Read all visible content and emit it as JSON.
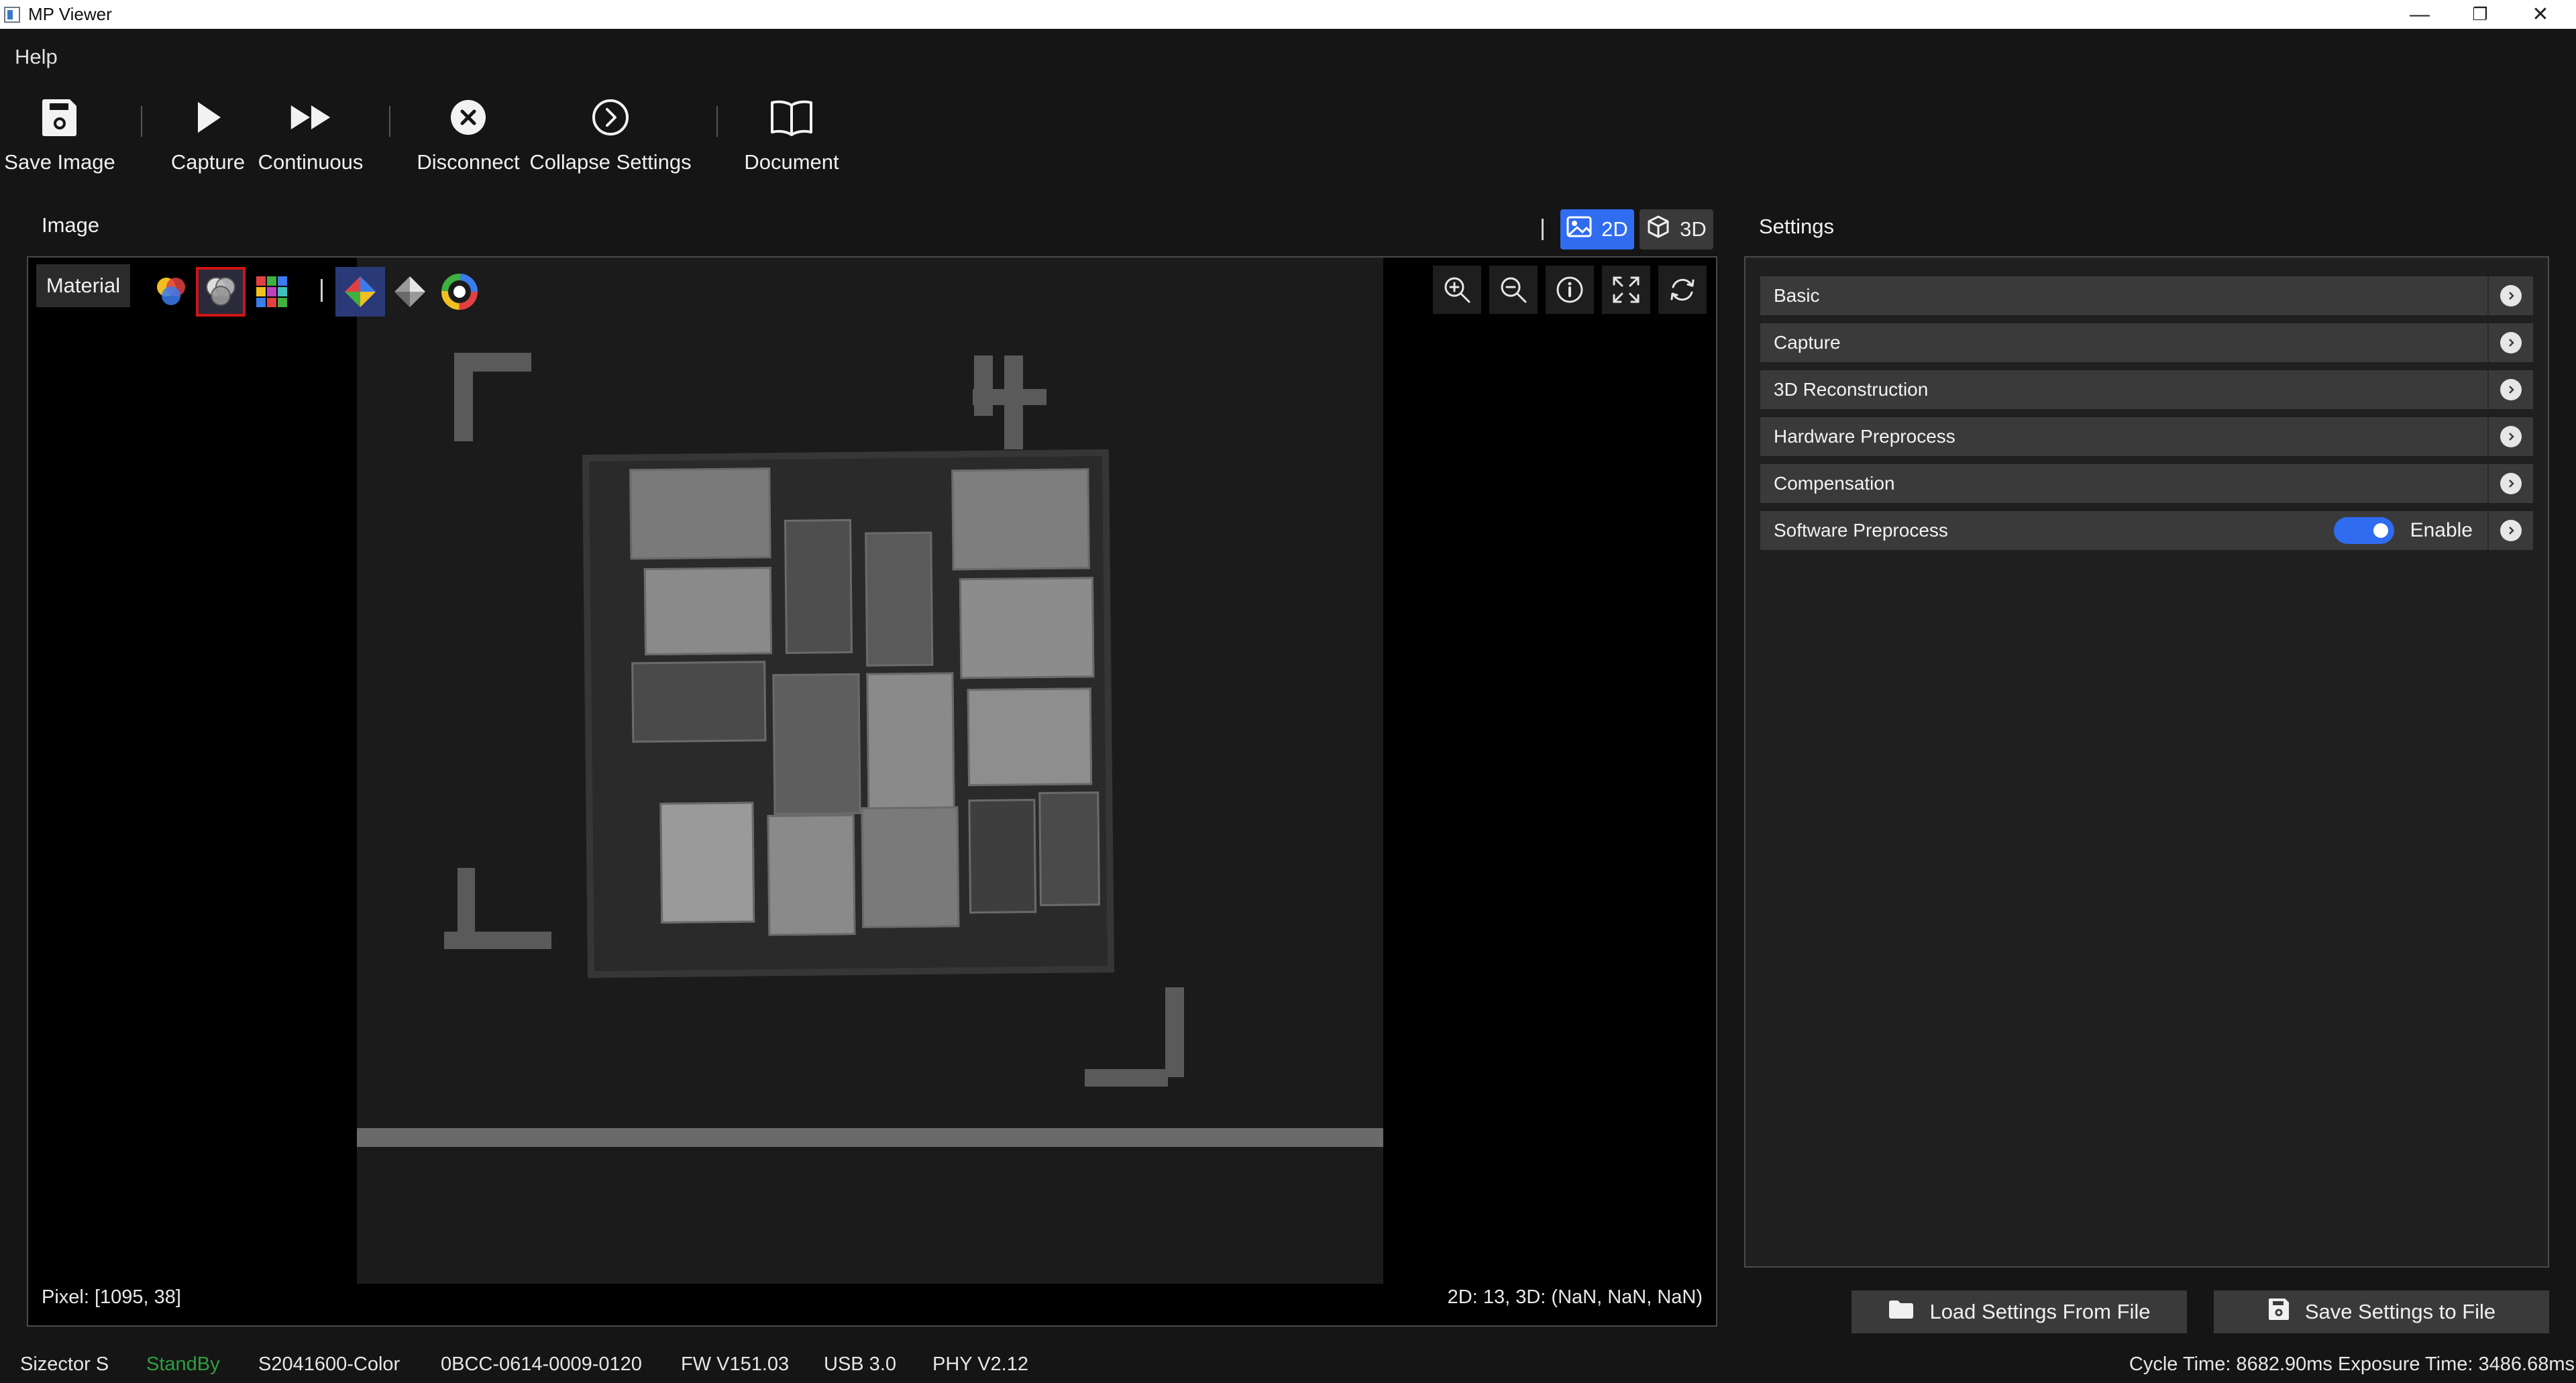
{
  "window": {
    "title": "MP Viewer",
    "minimize": "—",
    "restore": "❐",
    "close": "✕"
  },
  "menu": {
    "help": "Help"
  },
  "toolbar": {
    "save_image": "Save Image",
    "capture": "Capture",
    "continuous": "Continuous",
    "disconnect": "Disconnect",
    "collapse_settings": "Collapse Settings",
    "document": "Document"
  },
  "image_panel": {
    "title": "Image",
    "view_2d": "2D",
    "view_3d": "3D",
    "material_button": "Material",
    "pixel_readout": "Pixel: [1095, 38]",
    "value_readout": "2D: 13, 3D: (NaN, NaN, NaN)"
  },
  "settings_panel": {
    "title": "Settings",
    "sections": [
      {
        "label": "Basic"
      },
      {
        "label": "Capture"
      },
      {
        "label": "3D Reconstruction"
      },
      {
        "label": "Hardware Preprocess"
      },
      {
        "label": "Compensation"
      },
      {
        "label": "Software Preprocess",
        "toggle_label": "Enable",
        "enabled": true
      }
    ],
    "load_button": "Load Settings From File",
    "save_button": "Save Settings to File"
  },
  "status_bar": {
    "camera_model": "Sizector S",
    "state": "StandBy",
    "serial": "S2041600-Color",
    "device_id": "0BCC-0614-0009-0120",
    "firmware": "FW V151.03",
    "usb": "USB 3.0",
    "phy": "PHY V2.12",
    "timing": "Cycle Time: 8682.90ms Exposure Time: 3486.68ms"
  },
  "colors": {
    "accent_blue": "#2f6cf0",
    "state_green": "#2e9e3e",
    "selection_red": "#d01515"
  }
}
